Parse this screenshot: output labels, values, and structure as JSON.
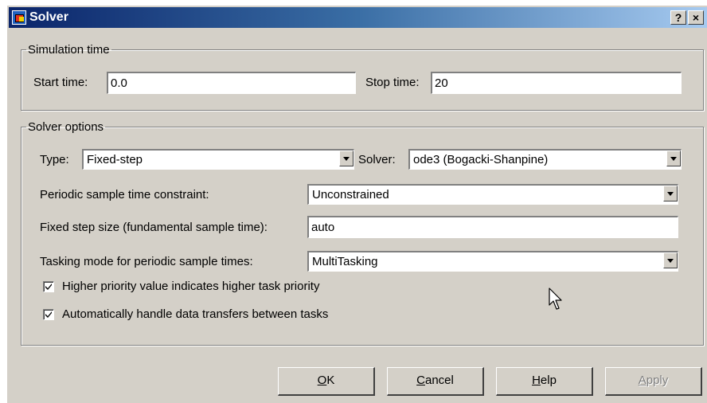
{
  "window": {
    "title": "Solver",
    "help_button": "?",
    "close_button": "×"
  },
  "simulation_time": {
    "legend": "Simulation time",
    "start_label": "Start time:",
    "start_value": "0.0",
    "stop_label": "Stop time:",
    "stop_value": "20"
  },
  "solver_options": {
    "legend": "Solver options",
    "type_label": "Type:",
    "type_value": "Fixed-step",
    "solver_label": "Solver:",
    "solver_value": "ode3 (Bogacki-Shanpine)",
    "periodic_label": "Periodic sample time constraint:",
    "periodic_value": "Unconstrained",
    "step_label": "Fixed step size (fundamental sample time):",
    "step_value": "auto",
    "tasking_label": "Tasking mode for periodic sample times:",
    "tasking_value": "MultiTasking",
    "priority_label": "Higher priority value indicates higher task priority",
    "priority_checked": true,
    "transfer_label": "Automatically handle data transfers between tasks",
    "transfer_checked": true
  },
  "buttons": {
    "ok_first": "O",
    "ok_rest": "K",
    "cancel_first": "C",
    "cancel_rest": "ancel",
    "help_first": "H",
    "help_rest": "elp",
    "apply_first": "A",
    "apply_rest": "pply"
  }
}
